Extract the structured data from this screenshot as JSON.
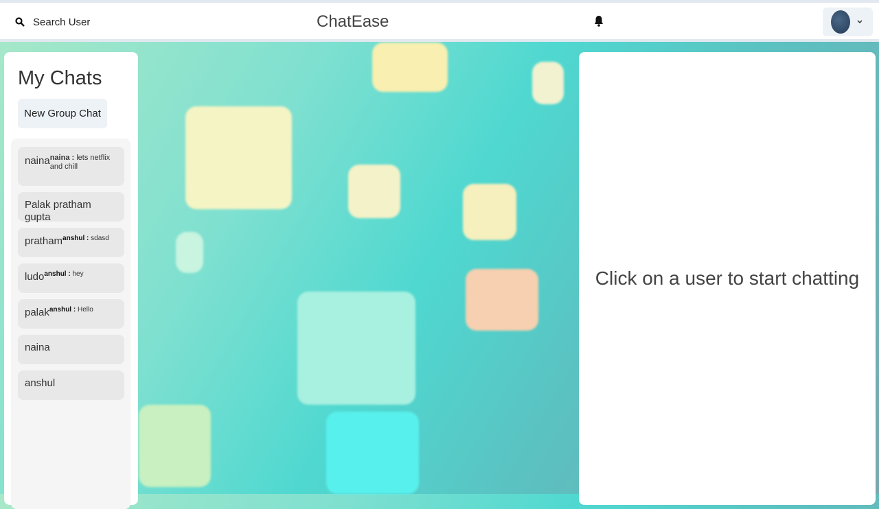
{
  "header": {
    "search_label": "Search User",
    "app_title": "ChatEase"
  },
  "sidebar": {
    "title": "My Chats",
    "new_group_label": "New Group Chat",
    "chats": [
      {
        "name": "naina",
        "sender": "naina :",
        "message": "lets netflix and chill"
      },
      {
        "name": "Palak pratham gupta"
      },
      {
        "name": "pratham",
        "sender": "anshul :",
        "message": "sdasd"
      },
      {
        "name": "ludo",
        "sender": "anshul :",
        "message": "hey"
      },
      {
        "name": "palak",
        "sender": "anshul :",
        "message": "Hello"
      },
      {
        "name": "naina"
      },
      {
        "name": "anshul"
      }
    ]
  },
  "chat_panel": {
    "placeholder": "Click on a user to start chatting"
  }
}
